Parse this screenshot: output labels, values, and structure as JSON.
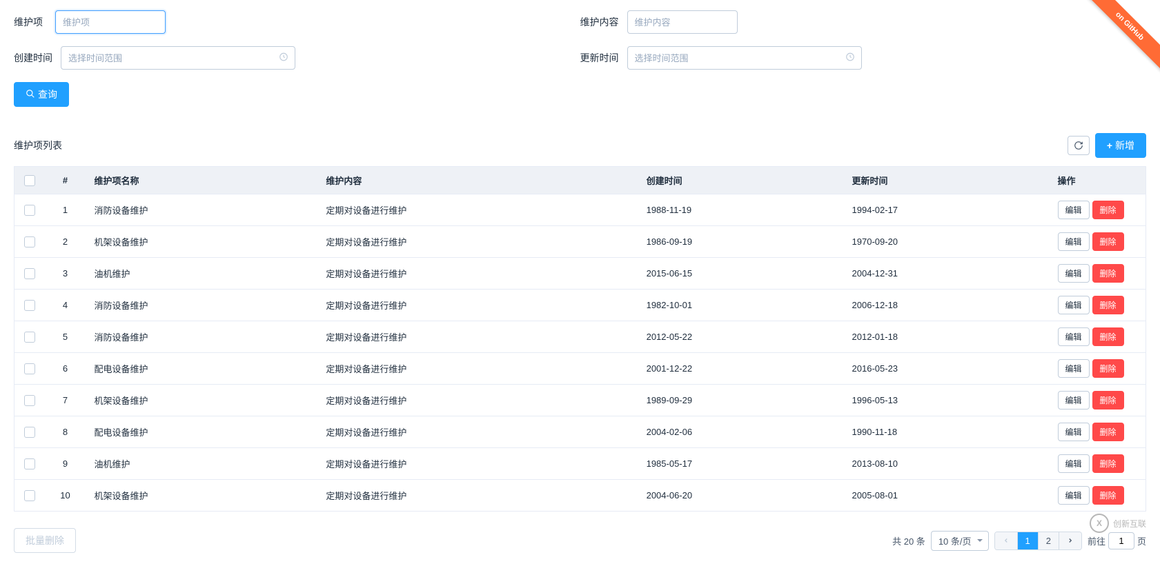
{
  "filters": {
    "name_label": "维护项",
    "name_placeholder": "维护项",
    "content_label": "维护内容",
    "content_placeholder": "维护内容",
    "created_label": "创建时间",
    "created_placeholder": "选择时间范围",
    "updated_label": "更新时间",
    "updated_placeholder": "选择时间范围",
    "search_btn": "查询"
  },
  "list": {
    "title": "维护项列表",
    "add_btn": "新增",
    "columns": {
      "index": "#",
      "name": "维护项名称",
      "content": "维护内容",
      "created": "创建时间",
      "updated": "更新时间",
      "op": "操作"
    },
    "edit_btn": "编辑",
    "delete_btn": "删除",
    "batch_delete_btn": "批量删除",
    "rows": [
      {
        "idx": "1",
        "name": "消防设备维护",
        "content": "定期对设备进行维护",
        "created": "1988-11-19",
        "updated": "1994-02-17"
      },
      {
        "idx": "2",
        "name": "机架设备维护",
        "content": "定期对设备进行维护",
        "created": "1986-09-19",
        "updated": "1970-09-20"
      },
      {
        "idx": "3",
        "name": "油机维护",
        "content": "定期对设备进行维护",
        "created": "2015-06-15",
        "updated": "2004-12-31"
      },
      {
        "idx": "4",
        "name": "消防设备维护",
        "content": "定期对设备进行维护",
        "created": "1982-10-01",
        "updated": "2006-12-18"
      },
      {
        "idx": "5",
        "name": "消防设备维护",
        "content": "定期对设备进行维护",
        "created": "2012-05-22",
        "updated": "2012-01-18"
      },
      {
        "idx": "6",
        "name": "配电设备维护",
        "content": "定期对设备进行维护",
        "created": "2001-12-22",
        "updated": "2016-05-23"
      },
      {
        "idx": "7",
        "name": "机架设备维护",
        "content": "定期对设备进行维护",
        "created": "1989-09-29",
        "updated": "1996-05-13"
      },
      {
        "idx": "8",
        "name": "配电设备维护",
        "content": "定期对设备进行维护",
        "created": "2004-02-06",
        "updated": "1990-11-18"
      },
      {
        "idx": "9",
        "name": "油机维护",
        "content": "定期对设备进行维护",
        "created": "1985-05-17",
        "updated": "2013-08-10"
      },
      {
        "idx": "10",
        "name": "机架设备维护",
        "content": "定期对设备进行维护",
        "created": "2004-06-20",
        "updated": "2005-08-01"
      }
    ]
  },
  "pagination": {
    "total_text": "共 20 条",
    "pagesize_text": "10 条/页",
    "pages": [
      "1",
      "2"
    ],
    "current_page": "1",
    "goto_prefix": "前往",
    "goto_value": "1",
    "goto_suffix": "页"
  },
  "ribbon": "on GitHub",
  "watermark": "创新互联"
}
